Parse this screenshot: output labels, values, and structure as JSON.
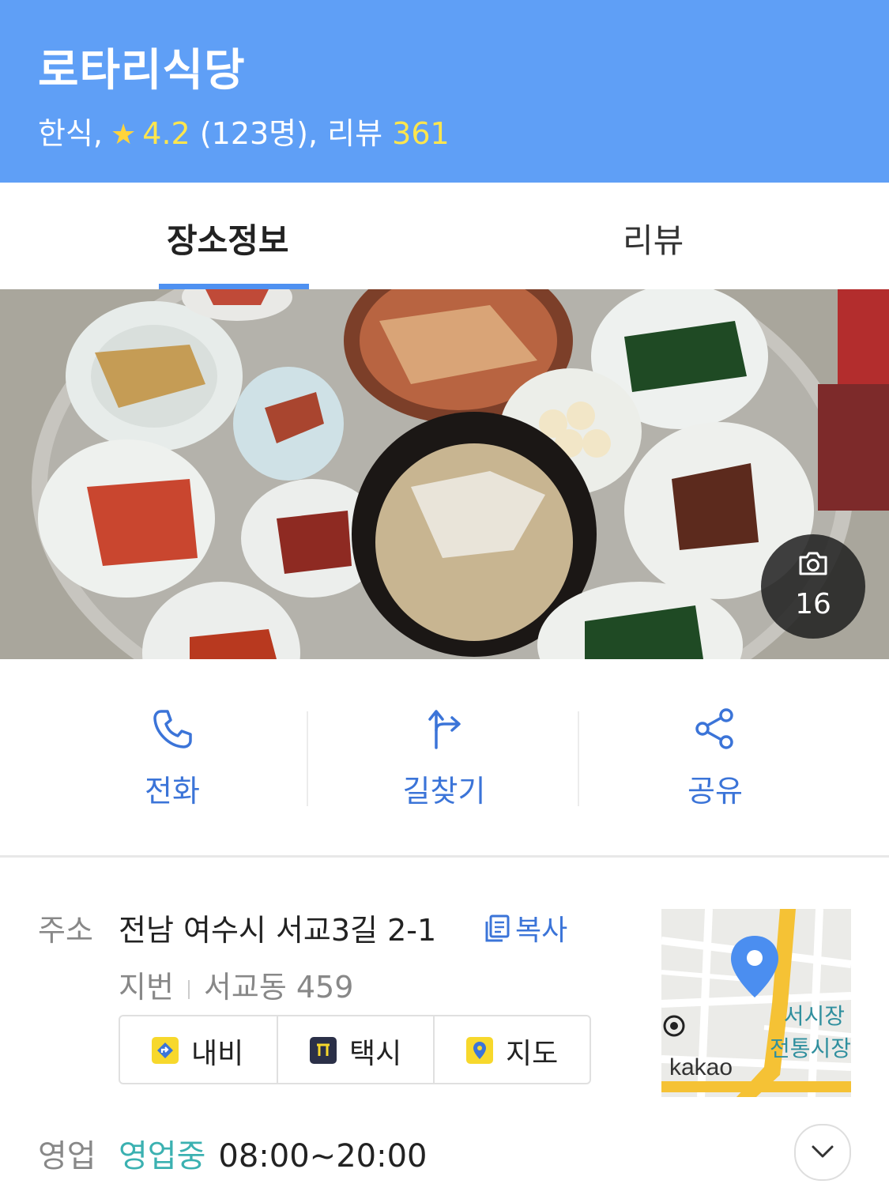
{
  "header": {
    "title": "로타리식당",
    "category": "한식,",
    "rating": "4.2",
    "rating_count": "(123명),",
    "review_label": "리뷰",
    "review_count": "361"
  },
  "tabs": [
    {
      "label": "장소정보",
      "active": true
    },
    {
      "label": "리뷰",
      "active": false
    }
  ],
  "photo": {
    "count": "16"
  },
  "actions": [
    {
      "label": "전화",
      "icon": "phone-icon"
    },
    {
      "label": "길찾기",
      "icon": "directions-icon"
    },
    {
      "label": "공유",
      "icon": "share-icon"
    }
  ],
  "address": {
    "label": "주소",
    "value": "전남 여수시 서교3길 2-1",
    "copy_label": "복사",
    "jibun_label": "지번",
    "jibun_value": "서교동 459"
  },
  "nav_buttons": [
    {
      "label": "내비",
      "icon": "navi-icon"
    },
    {
      "label": "택시",
      "icon": "taxi-icon"
    },
    {
      "label": "지도",
      "icon": "map-pin-icon"
    }
  ],
  "map": {
    "labels": [
      "서시장",
      "전통시장",
      "kakao"
    ]
  },
  "hours": {
    "label": "영업",
    "status": "영업중",
    "time": "08:00~20:00"
  },
  "colors": {
    "header_bg": "#5f9ff6",
    "accent": "#3b74d8",
    "tab_underline": "#4f91f1",
    "open_status": "#3bb1b1",
    "star": "#ffd43b"
  }
}
